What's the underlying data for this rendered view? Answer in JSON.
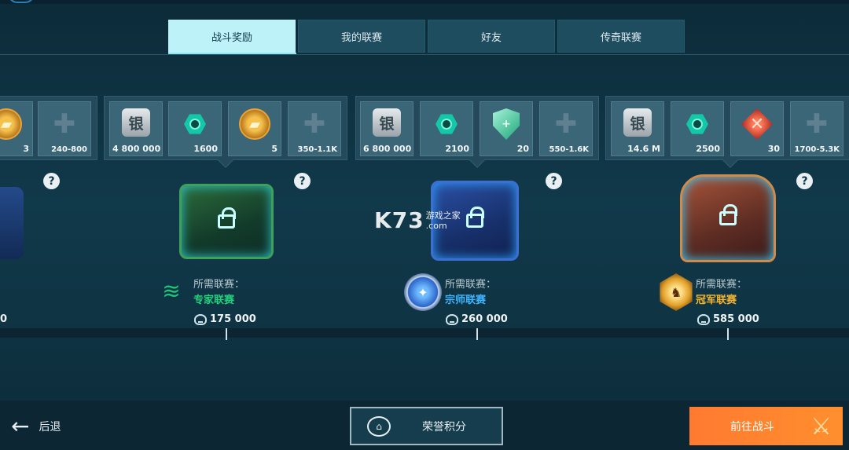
{
  "tabs": [
    {
      "label": "战斗奖励",
      "active": true
    },
    {
      "label": "我的联赛",
      "active": false
    },
    {
      "label": "好友",
      "active": false
    },
    {
      "label": "传奇联赛",
      "active": false
    }
  ],
  "reward_groups": [
    {
      "tiles": [
        {
          "type": "gold",
          "icon": "gold-bars-icon",
          "amount": "3"
        },
        {
          "type": "puzzle",
          "icon": "puzzle-piece-icon",
          "amount": "240-800"
        }
      ]
    },
    {
      "tiles": [
        {
          "type": "silver",
          "icon": "silver-icon",
          "glyph": "银",
          "amount": "4 800 000"
        },
        {
          "type": "gem",
          "icon": "gem-icon",
          "amount": "1600"
        },
        {
          "type": "gold",
          "icon": "gold-bars-icon",
          "amount": "5"
        },
        {
          "type": "puzzle",
          "icon": "puzzle-piece-icon",
          "amount": "350-1.1K"
        }
      ]
    },
    {
      "tiles": [
        {
          "type": "silver",
          "icon": "silver-icon",
          "glyph": "银",
          "amount": "6 800 000"
        },
        {
          "type": "gem",
          "icon": "gem-icon",
          "amount": "2100"
        },
        {
          "type": "shield",
          "icon": "shield-icon",
          "amount": "20"
        },
        {
          "type": "puzzle",
          "icon": "puzzle-piece-icon",
          "amount": "550-1.6K"
        }
      ]
    },
    {
      "tiles": [
        {
          "type": "silver",
          "icon": "silver-icon",
          "glyph": "银",
          "amount": "14.6 M"
        },
        {
          "type": "gem",
          "icon": "gem-icon",
          "amount": "2500"
        },
        {
          "type": "swords",
          "icon": "crossed-swords-icon",
          "amount": "30"
        },
        {
          "type": "puzzle",
          "icon": "puzzle-piece-icon",
          "amount": "1700-5.3K"
        }
      ]
    }
  ],
  "help_symbol": "?",
  "leagues": [
    {
      "points_partial": "0"
    },
    {
      "required_label": "所需联赛：",
      "league_name": "专家联赛",
      "name_color": "#22d07a",
      "points": "175 000"
    },
    {
      "required_label": "所需联赛：",
      "league_name": "宗师联赛",
      "name_color": "#3fb4ff",
      "points": "260 000"
    },
    {
      "required_label": "所需联赛：",
      "league_name": "冠军联赛",
      "name_color": "#f5b42e",
      "points": "585 000"
    }
  ],
  "watermark": {
    "logo": "K73",
    "line1": "游戏之家",
    "line2": ".com"
  },
  "bottom": {
    "back_label": "后退",
    "honor_label": "荣誉积分",
    "battle_label": "前往战斗"
  },
  "colors": {
    "accent_tab": "#bdf2f8",
    "battle_button": "#ff7a30",
    "background": "#0e2f3d"
  }
}
